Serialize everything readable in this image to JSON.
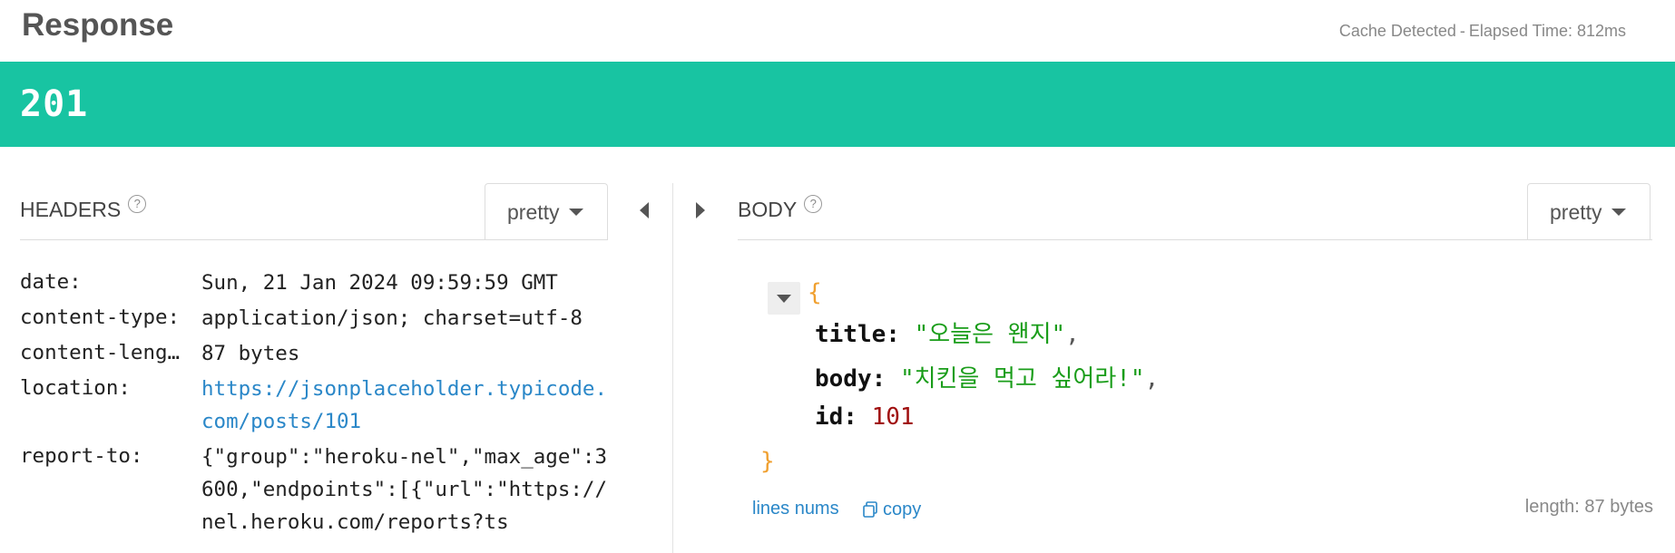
{
  "header": {
    "title": "Response",
    "cache_text": "Cache Detected",
    "separator": "-",
    "elapsed_text": "Elapsed Time: 812ms"
  },
  "status": {
    "code": "201",
    "color": "#18c4a2"
  },
  "headers_panel": {
    "title": "HEADERS",
    "help": "?",
    "format_label": "pretty",
    "rows": [
      {
        "key": "date:",
        "value": "Sun, 21 Jan 2024 09:59:59 GMT"
      },
      {
        "key": "content-type:",
        "value": "application/json; charset=utf-8"
      },
      {
        "key": "content-leng…",
        "value": "87 bytes"
      },
      {
        "key": "location:",
        "value": "https://jsonplaceholder.typicode.com/posts/101"
      },
      {
        "key": "report-to:",
        "value": "{\"group\":\"heroku-nel\",\"max_age\":3600,\"endpoints\":[{\"url\":\"https://nel.heroku.com/reports?ts"
      }
    ]
  },
  "body_panel": {
    "title": "BODY",
    "help": "?",
    "format_label": "pretty",
    "open_brace": "{",
    "close_brace": "}",
    "fields": [
      {
        "key": "title:",
        "value": "\"오늘은 왠지\"",
        "comma": ","
      },
      {
        "key": "body:",
        "value": "\"치킨을 먹고 싶어라!\"",
        "comma": ","
      },
      {
        "key": "id:",
        "value": "101",
        "comma": ""
      }
    ],
    "lines_nums_label": "lines nums",
    "copy_label": "copy",
    "length_text": "length: 87 bytes"
  },
  "icons": [
    "help-icon",
    "chevron-down-icon",
    "collapse-left-icon",
    "expand-right-icon",
    "copy-icon",
    "collapse-tree-icon"
  ]
}
